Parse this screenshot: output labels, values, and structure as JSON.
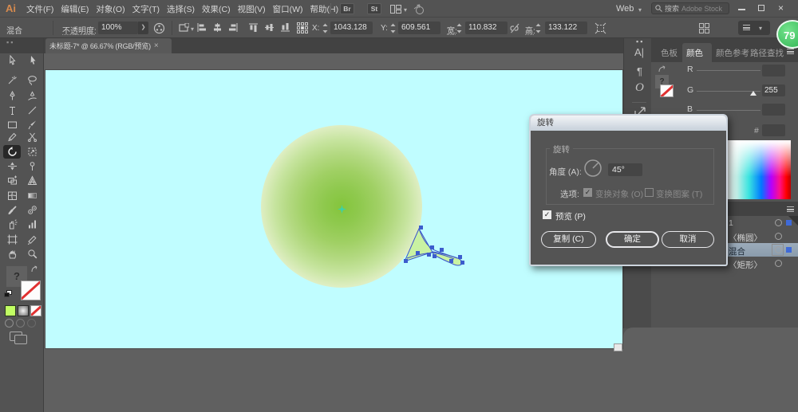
{
  "menubar": {
    "logo": "Ai",
    "menus": [
      "文件(F)",
      "编辑(E)",
      "对象(O)",
      "文字(T)",
      "选择(S)",
      "效果(C)",
      "视图(V)",
      "窗口(W)",
      "帮助(H)"
    ],
    "bridge_badge": "Br",
    "stock_badge": "St",
    "workspace_label": "Web",
    "search_label": "搜索",
    "search_placeholder": "Adobe Stock",
    "minimize": "–",
    "close": "×"
  },
  "controlbar": {
    "selection_type": "混合",
    "opacity_label": "不透明度:",
    "opacity_value": "100%",
    "x_label": "X:",
    "x_value": "1043.128",
    "y_label": "Y:",
    "y_value": "609.561",
    "w_label": "宽:",
    "w_value": "110.832",
    "h_label": "高:",
    "h_value": "133.122"
  },
  "document_tab": {
    "title": "未标题-7* @ 66.67% (RGB/预览)",
    "close": "×"
  },
  "toolbar": {
    "tools": [
      "selection",
      "direct-selection",
      "magic-wand",
      "lasso",
      "pen",
      "curvature",
      "type",
      "line-segment",
      "rectangle",
      "paintbrush",
      "pencil",
      "scissors",
      "rotate",
      "free-transform",
      "width",
      "puppet-warp",
      "shape-builder",
      "perspective-grid",
      "mesh",
      "gradient",
      "eyedropper",
      "blend",
      "symbol-sprayer",
      "column-graph",
      "artboard",
      "slice",
      "hand",
      "zoom"
    ],
    "active_tool": "rotate",
    "help_mark": "?"
  },
  "dialog": {
    "title": "旋转",
    "group_label": "旋转",
    "angle_label": "角度 (A):",
    "angle_value": "45°",
    "options_label": "选项:",
    "option_object": "变换对象 (O)",
    "option_pattern": "变换图案 (T)",
    "preview_label": "预览 (P)",
    "copy_button": "复制 (C)",
    "ok_button": "确定",
    "cancel_button": "取消",
    "check": "✓"
  },
  "panel": {
    "tabs": [
      "色板",
      "颜色",
      "颜色参考",
      "路径查找"
    ],
    "active_tab": "颜色",
    "color": {
      "r_label": "R",
      "g_label": "G",
      "b_label": "B",
      "g_value": "255",
      "hex_label": "#"
    },
    "layers": [
      {
        "name": "1",
        "blue_square": true,
        "selected": false,
        "boxed": false
      },
      {
        "name": "〈椭圆〉",
        "blue_square": false,
        "selected": false,
        "boxed": false
      },
      {
        "name": "混合",
        "blue_square": true,
        "selected": true,
        "boxed": true
      },
      {
        "name": "〈矩形〉",
        "blue_square": false,
        "selected": false,
        "boxed": false
      }
    ]
  },
  "badge": {
    "value": "79"
  },
  "colors": {
    "artboard": "#c0fdff",
    "fill_swatch": "#c1fe63",
    "selection_blue": "#4b79d1",
    "gradient_center": "#84c53c"
  }
}
